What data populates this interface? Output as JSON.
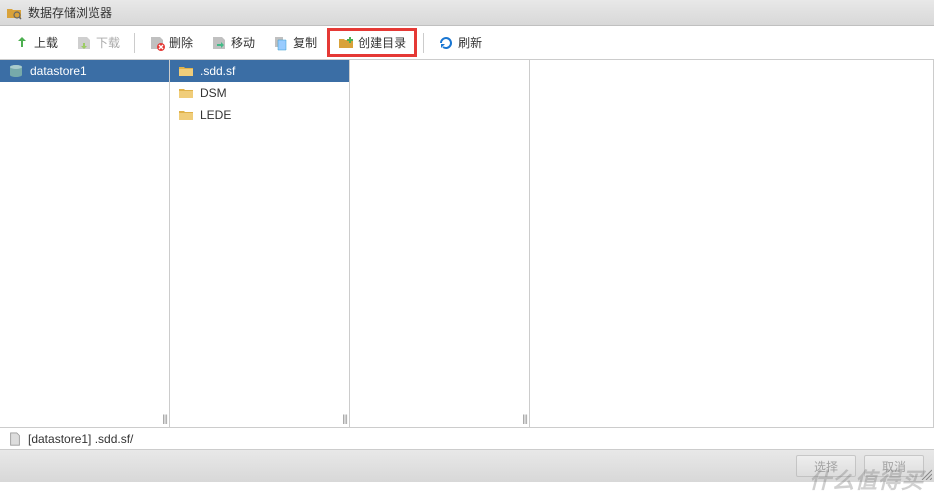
{
  "window": {
    "title": "数据存储浏览器"
  },
  "toolbar": {
    "upload": "上载",
    "download": "下载",
    "delete": "删除",
    "move": "移动",
    "copy": "复制",
    "create_dir": "创建目录",
    "refresh": "刷新"
  },
  "datastores": [
    {
      "name": "datastore1",
      "selected": true
    }
  ],
  "folders": [
    {
      "name": ".sdd.sf",
      "selected": true
    },
    {
      "name": "DSM",
      "selected": false
    },
    {
      "name": "LEDE",
      "selected": false
    }
  ],
  "path": "[datastore1] .sdd.sf/",
  "footer": {
    "select": "选择",
    "cancel": "取消"
  },
  "watermark": "什么值得买"
}
